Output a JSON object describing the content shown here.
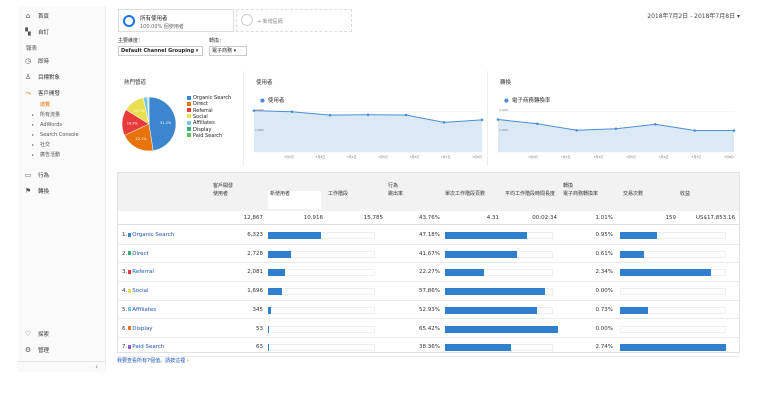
{
  "sidebar": {
    "items": [
      {
        "icon": "home-icon",
        "label": "首頁"
      },
      {
        "icon": "grid-icon",
        "label": "自訂"
      }
    ],
    "reports_heading": "報表",
    "sections": [
      {
        "icon": "clock-icon",
        "label": "即時"
      },
      {
        "icon": "person-icon",
        "label": "目標對象"
      },
      {
        "icon": "acquisition-icon",
        "label": "客戶開發"
      }
    ],
    "sub_items": [
      {
        "label": "總覽",
        "active": true
      },
      {
        "label": "所有流量",
        "active": false
      },
      {
        "label": "AdWords",
        "active": false
      },
      {
        "label": "Search Console",
        "active": false
      },
      {
        "label": "社交",
        "active": false
      },
      {
        "label": "廣告活動",
        "active": false
      }
    ],
    "more": [
      {
        "icon": "behavior-icon",
        "label": "行為"
      },
      {
        "icon": "flag-icon",
        "label": "轉換"
      }
    ],
    "bottom": [
      {
        "icon": "lightbulb-icon",
        "label": "探索"
      },
      {
        "icon": "gear-icon",
        "label": "管理"
      }
    ],
    "collapse_glyph": "‹"
  },
  "header": {
    "segment_name": "所有使用者",
    "segment_pct": "100.00% 個使用者",
    "add_segment": "+ 新增區隔",
    "date_range": "2018年7月2日 - 2018年7月8日 ▾",
    "dimension_label": "主要維度：",
    "dimension_value": "Default Channel Grouping ▾",
    "conversion_label": "轉換：",
    "conversion_value": "電子商務 ▾"
  },
  "panels": {
    "pie_title": "熱門管道",
    "users_title": "使用者",
    "users_metric": "使用者",
    "conv_title": "轉換",
    "conv_metric": "電子商務轉換率"
  },
  "chart_data": [
    {
      "type": "pie",
      "title": "熱門管道",
      "categories": [
        "Organic Search",
        "Direct",
        "Referral",
        "Social",
        "Affiliates",
        "Display",
        "Paid Search"
      ],
      "values": [
        51.2,
        22.1,
        16.9,
        13.7,
        2.8,
        0.4,
        0.5
      ],
      "slice_labels": [
        "51.2%",
        "22.1%",
        "16.9%",
        "13.7%",
        "",
        "",
        ""
      ],
      "colors": [
        "#3c86cf",
        "#e8730c",
        "#e83a3a",
        "#e8e050",
        "#7dc7e6",
        "#2fb36b",
        "#66c056"
      ],
      "legend": "right"
    },
    {
      "type": "line",
      "title": "使用者",
      "series": [
        {
          "name": "使用者",
          "values": [
            2020,
            1970,
            1800,
            1820,
            1810,
            1450,
            1570
          ]
        }
      ],
      "ylim": [
        0,
        2200
      ],
      "y_ticks": [
        "2,000",
        "1,000"
      ],
      "x": [
        "7月2日",
        "7月3日",
        "7月4日",
        "7月5日",
        "7月6日",
        "7月7日",
        "7月8日"
      ],
      "color": "#4a8fd6"
    },
    {
      "type": "line",
      "title": "轉換",
      "series": [
        {
          "name": "電子商務轉換率",
          "values": [
            1.3,
            1.13,
            0.87,
            0.93,
            1.11,
            0.86,
            0.86
          ]
        }
      ],
      "ylim": [
        0,
        1.8
      ],
      "y_ticks": [
        "2.00%",
        "1.00%"
      ],
      "x": [
        "7月2日",
        "7月3日",
        "7月4日",
        "7月5日",
        "7月6日",
        "7月7日",
        "7月8日"
      ],
      "color": "#4a8fd6"
    }
  ],
  "table": {
    "groups": [
      "客戶開發",
      "行為",
      "轉換"
    ],
    "columns": [
      "使用者",
      "新使用者",
      "工作階段",
      "跳出率",
      "單次工作階段頁數",
      "平均工作階段時間長度",
      "電子商務轉換率",
      "交易次數",
      "收益"
    ],
    "totals": [
      "12,867",
      "10,916",
      "15,785",
      "43.76%",
      "4.31",
      "00:02:34",
      "1.01%",
      "159",
      "US$17,853.16"
    ],
    "rows": [
      {
        "idx": "1.",
        "name": "Organic Search",
        "color": "#3c86cf",
        "users": "6,323",
        "users_pct": 49.1,
        "bounce": "47.18%",
        "bounce_pct": 47.18,
        "conv": "0.95%",
        "conv_pct": 0.95
      },
      {
        "idx": "2.",
        "name": "Direct",
        "color": "#2fb36b",
        "users": "2,728",
        "users_pct": 21.2,
        "bounce": "41.67%",
        "bounce_pct": 41.67,
        "conv": "0.61%",
        "conv_pct": 0.61
      },
      {
        "idx": "3.",
        "name": "Referral",
        "color": "#e83a3a",
        "users": "2,081",
        "users_pct": 16.2,
        "bounce": "22.27%",
        "bounce_pct": 22.27,
        "conv": "2.34%",
        "conv_pct": 2.34
      },
      {
        "idx": "4.",
        "name": "Social",
        "color": "#e8e050",
        "users": "1,696",
        "users_pct": 13.2,
        "bounce": "57.86%",
        "bounce_pct": 57.86,
        "conv": "0.00%",
        "conv_pct": 0
      },
      {
        "idx": "5.",
        "name": "Affiliates",
        "color": "#7dc7e6",
        "users": "345",
        "users_pct": 2.7,
        "bounce": "52.93%",
        "bounce_pct": 52.93,
        "conv": "0.73%",
        "conv_pct": 0.73
      },
      {
        "idx": "6.",
        "name": "Display",
        "color": "#e8730c",
        "users": "53",
        "users_pct": 0.4,
        "bounce": "65.42%",
        "bounce_pct": 65.42,
        "conv": "0.00%",
        "conv_pct": 0
      },
      {
        "idx": "7.",
        "name": "Paid Search",
        "color": "#9c5bd1",
        "users": "63",
        "users_pct": 0.5,
        "bounce": "38.36%",
        "bounce_pct": 38.36,
        "conv": "2.74%",
        "conv_pct": 2.74
      }
    ]
  },
  "footer": {
    "text": "我要查看所有7個值。請按這裡",
    "link": "這裡",
    "suffix": " ›"
  }
}
